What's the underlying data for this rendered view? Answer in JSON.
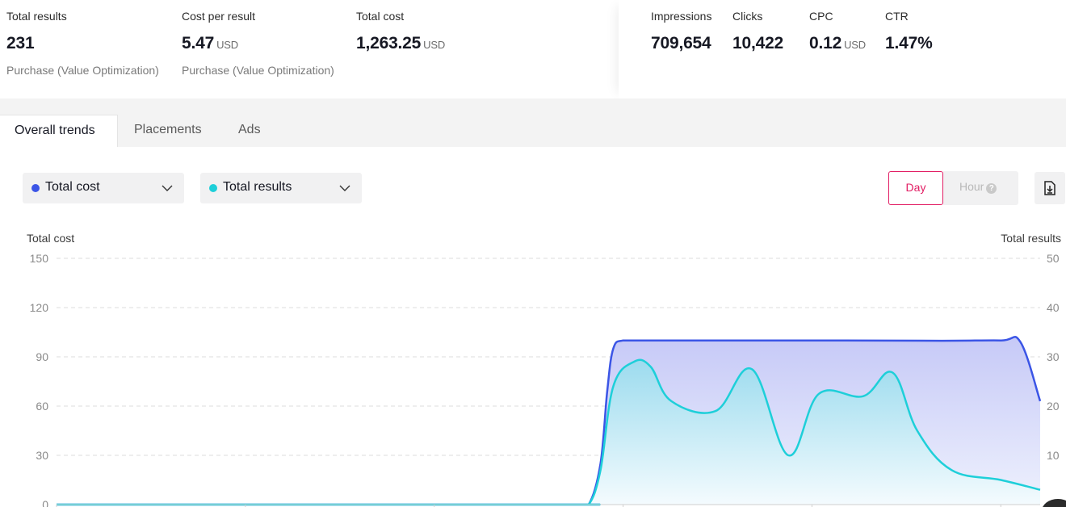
{
  "summary_left": [
    {
      "label": "Total results",
      "value": "231",
      "unit": "",
      "sub": "Purchase (Value Optimization)"
    },
    {
      "label": "Cost per result",
      "value": "5.47",
      "unit": "USD",
      "sub": "Purchase (Value Optimization)"
    },
    {
      "label": "Total cost",
      "value": "1,263.25",
      "unit": "USD",
      "sub": ""
    }
  ],
  "summary_right": [
    {
      "label": "Impressions",
      "value": "709,654",
      "unit": ""
    },
    {
      "label": "Clicks",
      "value": "10,422",
      "unit": ""
    },
    {
      "label": "CPC",
      "value": "0.12",
      "unit": "USD"
    },
    {
      "label": "CTR",
      "value": "1.47%",
      "unit": ""
    }
  ],
  "tabs": [
    "Overall trends",
    "Placements",
    "Ads"
  ],
  "active_tab": "Overall trends",
  "metric_selectors": [
    {
      "label": "Total cost",
      "color": "#3b55e6"
    },
    {
      "label": "Total results",
      "color": "#1ecfd9"
    }
  ],
  "granularity": {
    "day": "Day",
    "hour": "Hour",
    "selected": "Day"
  },
  "icons": {
    "export": "export-file-icon",
    "help": "question-circle-icon",
    "chevron": "chevron-down-icon"
  },
  "colors": {
    "accent": "#e21d63",
    "cost_series": "#3b55e6",
    "results_series": "#1ecfd9"
  },
  "chart_data": {
    "type": "area",
    "y_left_label": "Total cost",
    "y_right_label": "Total results",
    "y_left_ticks": [
      0,
      30,
      60,
      90,
      120,
      150
    ],
    "y_right_ticks": [
      0,
      10,
      20,
      30,
      40,
      50
    ],
    "ylim_left": [
      0,
      150
    ],
    "ylim_right": [
      0,
      50
    ],
    "grid": true,
    "series": [
      {
        "name": "Total cost",
        "axis": "left",
        "x": [
          0,
          0.264,
          0.527,
          0.541,
          0.553,
          0.56,
          0.566,
          0.576,
          0.6,
          0.7,
          0.8,
          0.9,
          0.96,
          0.98,
          1.0
        ],
        "values": [
          0,
          0,
          0,
          0,
          25,
          70,
          95,
          100,
          100,
          100,
          100,
          99.8,
          100,
          99,
          63
        ]
      },
      {
        "name": "Total results",
        "axis": "right",
        "x": [
          0,
          0.264,
          0.527,
          0.541,
          0.553,
          0.566,
          0.587,
          0.604,
          0.625,
          0.67,
          0.707,
          0.744,
          0.775,
          0.82,
          0.85,
          0.875,
          0.91,
          0.96,
          1.0
        ],
        "values": [
          0,
          0,
          0,
          0,
          7,
          24,
          29,
          28,
          21,
          19,
          27.5,
          10,
          22.5,
          22,
          26.8,
          15,
          7,
          5,
          3
        ]
      }
    ]
  }
}
